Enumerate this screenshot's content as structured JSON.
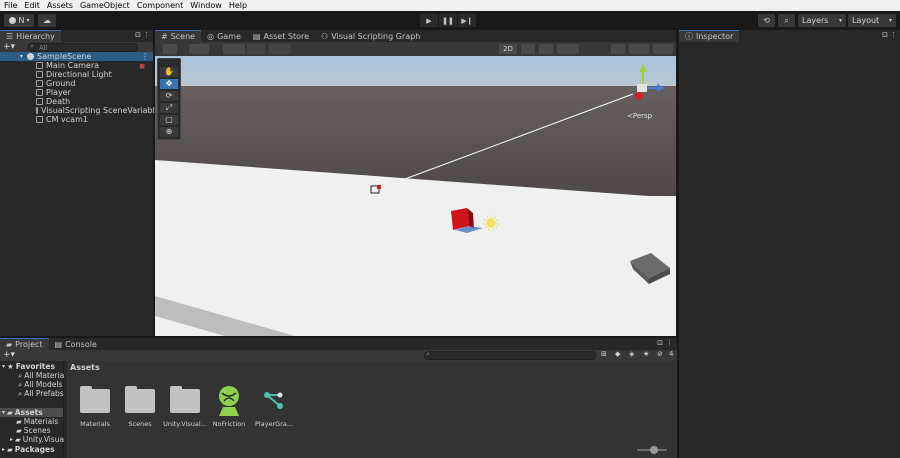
{
  "menu": [
    "File",
    "Edit",
    "Assets",
    "GameObject",
    "Component",
    "Window",
    "Help"
  ],
  "toolbar": {
    "account_label": "N",
    "layers_label": "Layers",
    "layout_label": "Layout"
  },
  "hierarchy": {
    "tab_label": "Hierarchy",
    "search_placeholder": "All",
    "scene_name": "SampleScene",
    "items": [
      "Main Camera",
      "Directional Light",
      "Ground",
      "Player",
      "Death",
      "VisualScripting SceneVariables",
      "CM vcam1"
    ]
  },
  "scene_tabs": [
    "Scene",
    "Game",
    "Asset Store",
    "Visual Scripting Graph"
  ],
  "scene": {
    "mode_2d": "2D",
    "persp_label": "Persp"
  },
  "inspector": {
    "tab_label": "Inspector"
  },
  "project": {
    "tabs": [
      "Project",
      "Console"
    ],
    "hidden_count": "4",
    "favorites_label": "Favorites",
    "favorites": [
      "All Materials",
      "All Models",
      "All Prefabs"
    ],
    "assets_label": "Assets",
    "asset_folders": [
      "Materials",
      "Scenes",
      "Unity.VisualScripting.Generated"
    ],
    "packages_label": "Packages",
    "breadcrumb": "Assets",
    "grid_items": [
      "Materials",
      "Scenes",
      "Unity.Visual...",
      "NoFriction",
      "PlayerGra..."
    ]
  },
  "colors": {
    "accent": "#3a72b0",
    "selection": "#2c5d87",
    "nofriction_green": "#8fd14f"
  }
}
